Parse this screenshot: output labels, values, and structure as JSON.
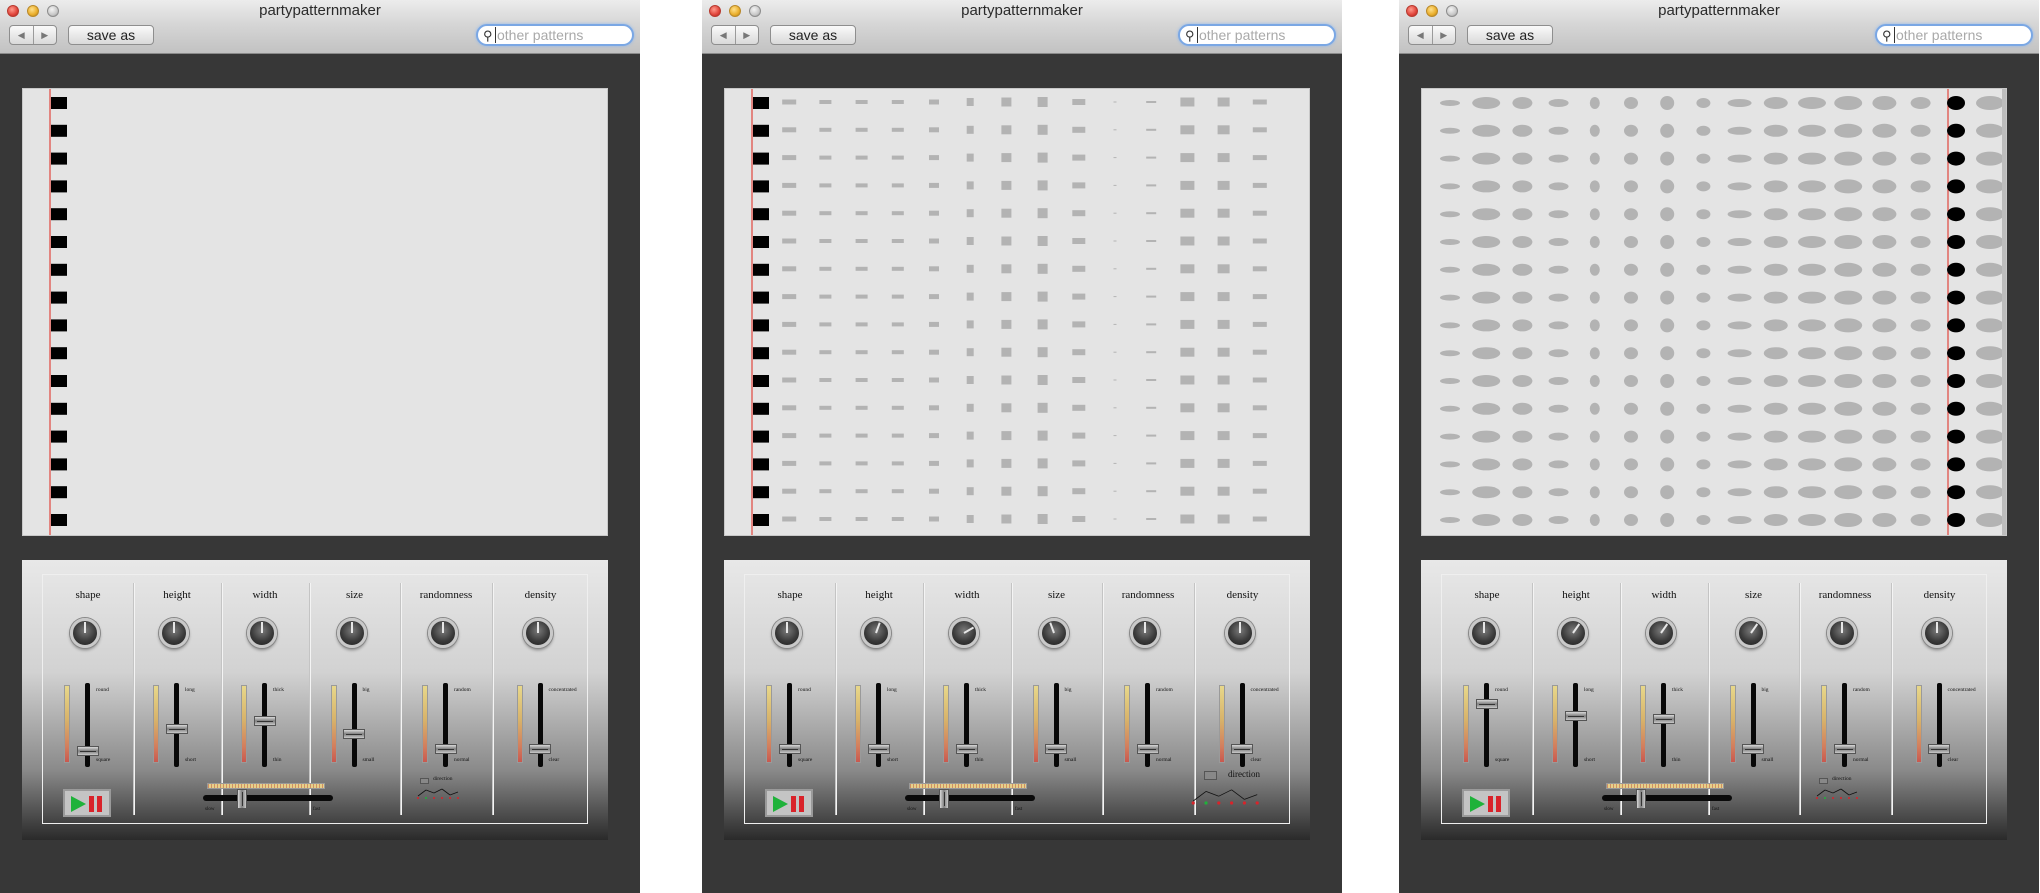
{
  "windows": [
    {
      "title": "partypatternmaker",
      "toolbar": {
        "back": "◀",
        "forward": "▶",
        "save_label": "save as",
        "search_placeholder": "other patterns"
      },
      "canvas": {
        "background": "#e4e4e4",
        "playhead_color": "#e0261d",
        "shape_color": "#000000",
        "ghost_color": "#b3b3b3",
        "rows": 16
      },
      "controls": {
        "columns": [
          {
            "label": "shape",
            "top": "round",
            "bottom": "square",
            "level": 0.15
          },
          {
            "label": "height",
            "top": "long",
            "bottom": "short",
            "level": 0.45
          },
          {
            "label": "width",
            "top": "thick",
            "bottom": "thin",
            "level": 0.55
          },
          {
            "label": "size",
            "top": "big",
            "bottom": "small",
            "level": 0.38
          },
          {
            "label": "randomness",
            "top": "random",
            "bottom": "normal",
            "level": 0.18
          },
          {
            "label": "density",
            "top": "concentrated",
            "bottom": "clear",
            "level": 0.18
          }
        ],
        "speed": {
          "slow": "slow",
          "fast": "fast",
          "level": 0.3
        },
        "direction_label": "direction"
      }
    },
    {
      "title": "partypatternmaker",
      "toolbar": {
        "back": "◀",
        "forward": "▶",
        "save_label": "save as",
        "search_placeholder": "other patterns"
      },
      "canvas": {
        "background": "#e4e4e4",
        "playhead_color": "#e0261d",
        "shape_color": "#000000",
        "ghost_color": "#b3b3b3",
        "rows": 16
      },
      "controls": {
        "columns": [
          {
            "label": "shape",
            "top": "round",
            "bottom": "square",
            "level": 0.18
          },
          {
            "label": "height",
            "top": "long",
            "bottom": "short",
            "level": 0.18
          },
          {
            "label": "width",
            "top": "thick",
            "bottom": "thin",
            "level": 0.18
          },
          {
            "label": "size",
            "top": "big",
            "bottom": "small",
            "level": 0.18
          },
          {
            "label": "randomness",
            "top": "random",
            "bottom": "normal",
            "level": 0.18
          },
          {
            "label": "density",
            "top": "concentrated",
            "bottom": "clear",
            "level": 0.18
          }
        ],
        "speed": {
          "slow": "slow",
          "fast": "fast",
          "level": 0.3
        },
        "direction_label": "direction"
      }
    },
    {
      "title": "partypatternmaker",
      "toolbar": {
        "back": "◀",
        "forward": "▶",
        "save_label": "save as",
        "search_placeholder": "other patterns"
      },
      "canvas": {
        "background": "#e4e4e4",
        "playhead_color": "#e0261d",
        "shape_color": "#000000",
        "ghost_color": "#b3b3b3",
        "rows": 16
      },
      "controls": {
        "columns": [
          {
            "label": "shape",
            "top": "round",
            "bottom": "square",
            "level": 0.78
          },
          {
            "label": "height",
            "top": "long",
            "bottom": "short",
            "level": 0.62
          },
          {
            "label": "width",
            "top": "thick",
            "bottom": "thin",
            "level": 0.58
          },
          {
            "label": "size",
            "top": "big",
            "bottom": "small",
            "level": 0.18
          },
          {
            "label": "randomness",
            "top": "random",
            "bottom": "normal",
            "level": 0.18
          },
          {
            "label": "density",
            "top": "concentrated",
            "bottom": "clear",
            "level": 0.18
          }
        ],
        "speed": {
          "slow": "slow",
          "fast": "fast",
          "level": 0.3
        },
        "direction_label": "direction"
      }
    }
  ]
}
